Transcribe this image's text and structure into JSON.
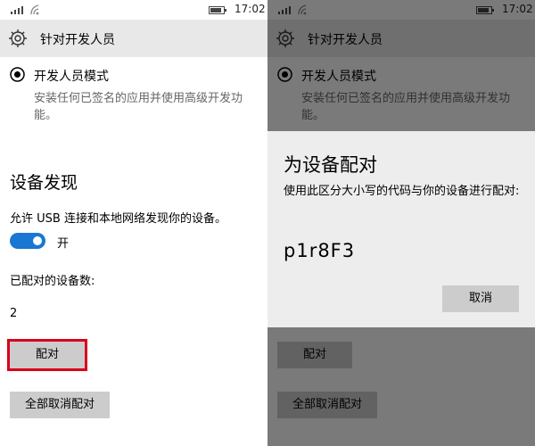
{
  "status": {
    "time": "17:02"
  },
  "header": {
    "title": "针对开发人员"
  },
  "developer_mode": {
    "label": "开发人员模式",
    "description": "安装任何已签名的应用并使用高级开发功能。"
  },
  "device_discovery": {
    "title": "设备发现",
    "description": "允许 USB 连接和本地网络发现你的设备。",
    "toggle_state": "开",
    "toggle_on": true,
    "paired_count_label": "已配对的设备数:",
    "paired_count": "2",
    "pair_button": "配对",
    "unpair_all_button": "全部取消配对"
  },
  "pair_dialog": {
    "title": "为设备配对",
    "description": "使用此区分大小写的代码与你的设备进行配对:",
    "code": "p1r8F3",
    "cancel_button": "取消"
  },
  "colors": {
    "accent": "#1976d2",
    "highlight_box": "#d9001b",
    "header_bg": "#e8e8e8",
    "button_bg": "#cccccc"
  },
  "icons": [
    "signal-icon",
    "wifi-icon",
    "battery-icon",
    "gear-icon",
    "radio-selected-icon"
  ]
}
